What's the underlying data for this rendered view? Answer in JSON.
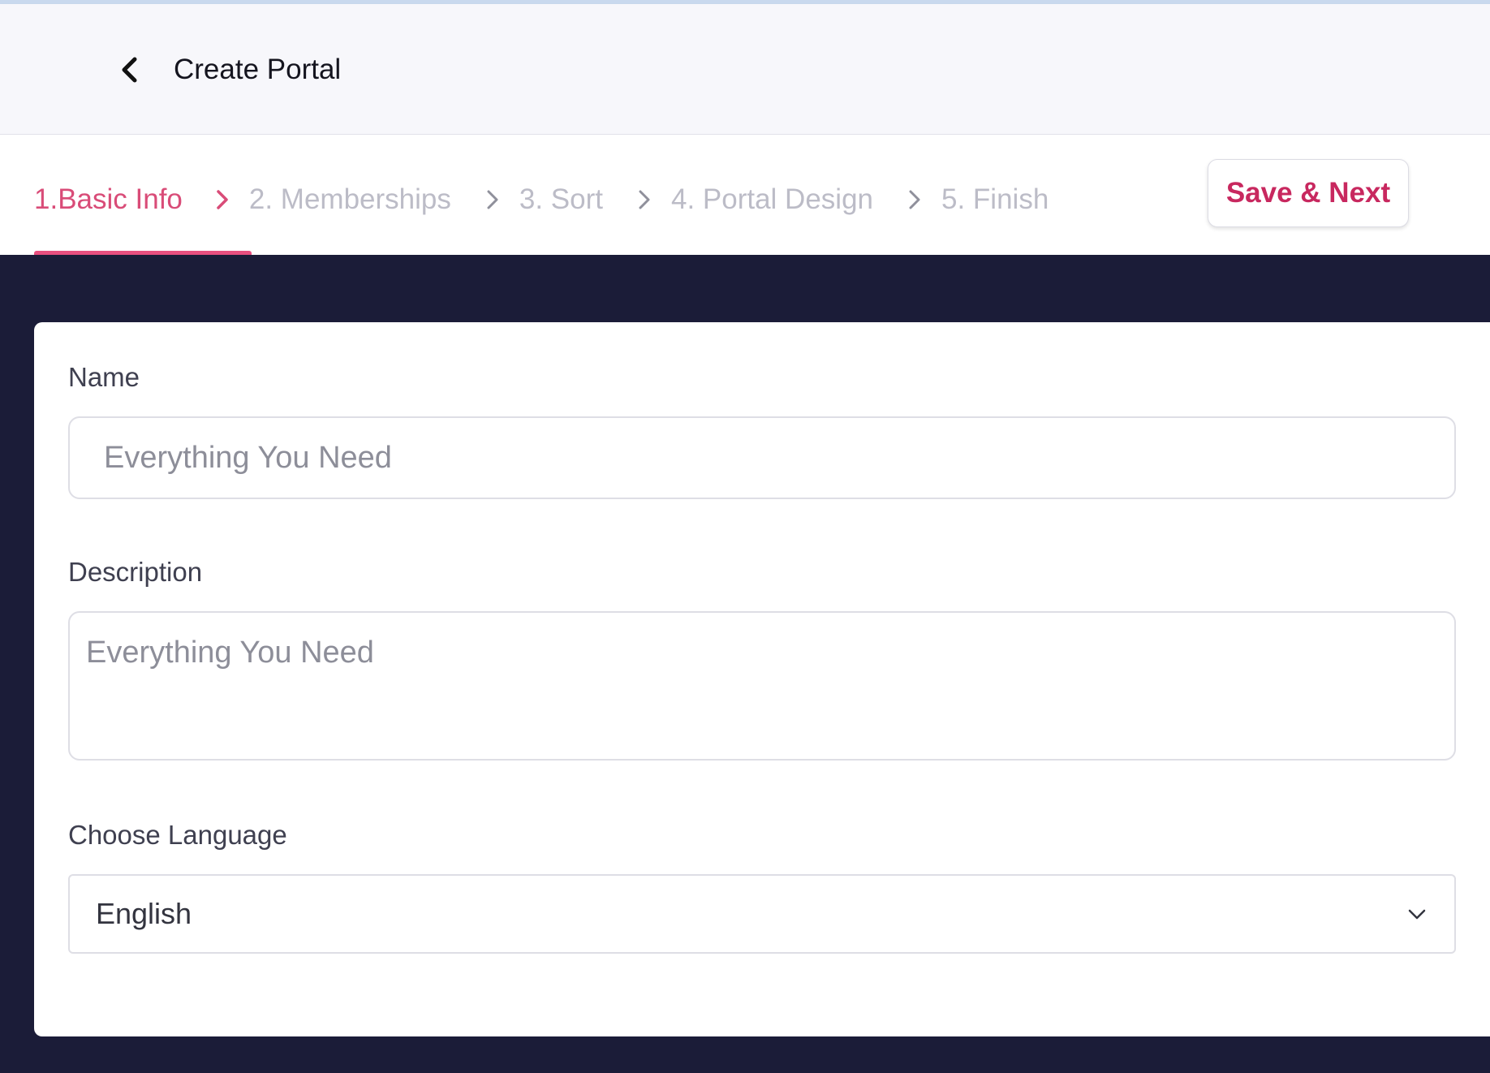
{
  "header": {
    "title": "Create Portal",
    "back_icon": "chevron-left-icon"
  },
  "steps": [
    {
      "label": "1.Basic Info",
      "active": true
    },
    {
      "label": "2. Memberships",
      "active": false
    },
    {
      "label": "3. Sort",
      "active": false
    },
    {
      "label": "4. Portal Design",
      "active": false
    },
    {
      "label": "5. Finish",
      "active": false
    }
  ],
  "actions": {
    "save_next_label": "Save & Next"
  },
  "form": {
    "name_label": "Name",
    "name_placeholder": "Everything You Need",
    "name_value": "",
    "description_label": "Description",
    "description_placeholder": "Everything You Need",
    "description_value": "",
    "language_label": "Choose Language",
    "language_value": "English"
  },
  "colors": {
    "accent": "#d94c78",
    "accent_button_text": "#c8285f",
    "background_dark": "#1b1c38",
    "inactive_step": "#bcbcc7"
  }
}
